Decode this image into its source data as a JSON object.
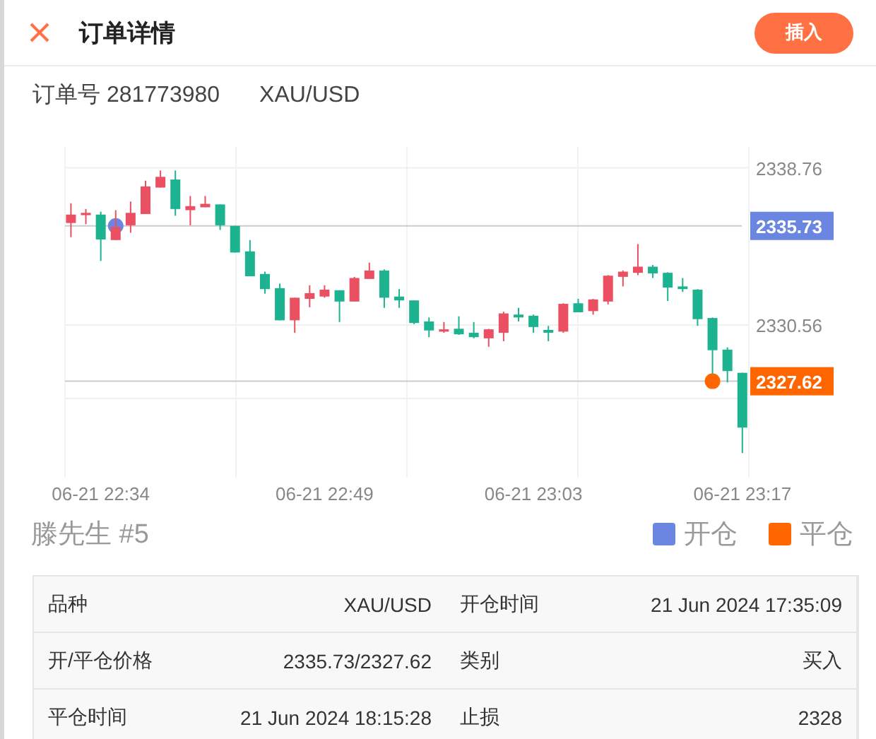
{
  "header": {
    "title": "订单详情",
    "action_button": "插入"
  },
  "order": {
    "number": "订单号 281773980",
    "symbol": "XAU/USD"
  },
  "chart": {
    "chart_data": {
      "type": "candlestick",
      "ohlc": [
        [
          2335.88,
          2336.91,
          2335.14,
          2336.32
        ],
        [
          2336.29,
          2336.61,
          2335.82,
          2336.41
        ],
        [
          2336.32,
          2336.47,
          2333.9,
          2335.02
        ],
        [
          2334.99,
          2336.55,
          2334.99,
          2335.67
        ],
        [
          2335.76,
          2337.0,
          2335.37,
          2336.41
        ],
        [
          2336.35,
          2338.09,
          2336.35,
          2337.79
        ],
        [
          2337.73,
          2338.62,
          2337.73,
          2338.29
        ],
        [
          2338.15,
          2338.62,
          2336.26,
          2336.61
        ],
        [
          2336.55,
          2337.29,
          2335.76,
          2336.76
        ],
        [
          2336.7,
          2337.29,
          2336.7,
          2336.88
        ],
        [
          2336.85,
          2336.85,
          2335.52,
          2335.76
        ],
        [
          2335.73,
          2335.73,
          2334.34,
          2334.34
        ],
        [
          2334.4,
          2334.99,
          2333.1,
          2333.1
        ],
        [
          2333.22,
          2333.34,
          2332.19,
          2332.43
        ],
        [
          2332.48,
          2332.72,
          2330.8,
          2330.8
        ],
        [
          2330.8,
          2331.98,
          2330.15,
          2331.98
        ],
        [
          2331.92,
          2332.63,
          2331.48,
          2332.22
        ],
        [
          2332.04,
          2332.63,
          2331.98,
          2332.4
        ],
        [
          2332.37,
          2332.37,
          2330.71,
          2331.78
        ],
        [
          2331.78,
          2333.07,
          2331.78,
          2333.01
        ],
        [
          2332.96,
          2333.81,
          2332.96,
          2333.4
        ],
        [
          2333.4,
          2333.46,
          2331.45,
          2331.98
        ],
        [
          2332.04,
          2332.43,
          2331.45,
          2331.84
        ],
        [
          2331.84,
          2331.84,
          2330.6,
          2330.66
        ],
        [
          2330.74,
          2330.95,
          2329.92,
          2330.27
        ],
        [
          2330.21,
          2330.71,
          2330.15,
          2330.33
        ],
        [
          2330.36,
          2331.01,
          2330.04,
          2330.07
        ],
        [
          2330.15,
          2330.71,
          2329.86,
          2329.92
        ],
        [
          2329.86,
          2330.36,
          2329.42,
          2330.33
        ],
        [
          2330.15,
          2331.25,
          2329.71,
          2331.16
        ],
        [
          2331.1,
          2331.45,
          2330.74,
          2330.95
        ],
        [
          2331.04,
          2331.1,
          2330.15,
          2330.45
        ],
        [
          2330.3,
          2330.51,
          2329.71,
          2330.15
        ],
        [
          2330.21,
          2331.69,
          2330.15,
          2331.66
        ],
        [
          2331.69,
          2331.92,
          2331.22,
          2331.22
        ],
        [
          2331.28,
          2331.92,
          2331.1,
          2331.89
        ],
        [
          2331.78,
          2333.16,
          2331.63,
          2333.13
        ],
        [
          2333.07,
          2333.4,
          2332.57,
          2333.34
        ],
        [
          2333.28,
          2334.78,
          2333.16,
          2333.6
        ],
        [
          2333.6,
          2333.69,
          2333.01,
          2333.25
        ],
        [
          2333.28,
          2333.31,
          2331.81,
          2332.51
        ],
        [
          2332.57,
          2333.01,
          2332.28,
          2332.43
        ],
        [
          2332.4,
          2332.43,
          2330.51,
          2330.86
        ],
        [
          2330.92,
          2330.95,
          2328.0,
          2329.24
        ],
        [
          2329.27,
          2329.39,
          2327.56,
          2328.15
        ],
        [
          2328.06,
          2328.06,
          2323.87,
          2325.2
        ]
      ],
      "categories": [
        null,
        null,
        "06-21 22:34",
        null,
        null,
        null,
        null,
        null,
        null,
        null,
        null,
        null,
        null,
        null,
        null,
        null,
        null,
        "06-21 22:49",
        null,
        null,
        null,
        null,
        null,
        null,
        null,
        null,
        null,
        null,
        null,
        null,
        null,
        "06-21 23:03",
        null,
        null,
        null,
        null,
        null,
        null,
        null,
        null,
        null,
        null,
        null,
        null,
        null,
        "06-21 23:17"
      ],
      "grid": true,
      "ylim": [
        2322.59,
        2339.85
      ],
      "yticks": [
        {
          "value": 2327.62,
          "label": "2327.62"
        },
        2330.56,
        {
          "value": 2335.73,
          "label": "2335.73"
        },
        2338.76
      ]
    }
  },
  "legend": {
    "trader": "滕先生 #5",
    "items": [
      {
        "label": "开仓",
        "color": "#6b86e0"
      },
      {
        "label": "平仓",
        "color": "#ff6600"
      }
    ]
  },
  "details": {
    "cells": [
      {
        "label": "品种",
        "value": "XAU/USD"
      },
      {
        "label": "开仓时间",
        "value": "21 Jun 2024 17:35:09"
      },
      {
        "label": "开/平仓价格",
        "value": "2335.73/2327.62"
      },
      {
        "label": "类别",
        "value": "买入"
      },
      {
        "label": "平仓时间",
        "value": "21 Jun 2024 18:15:28"
      },
      {
        "label": "止损",
        "value": "2328"
      }
    ]
  }
}
